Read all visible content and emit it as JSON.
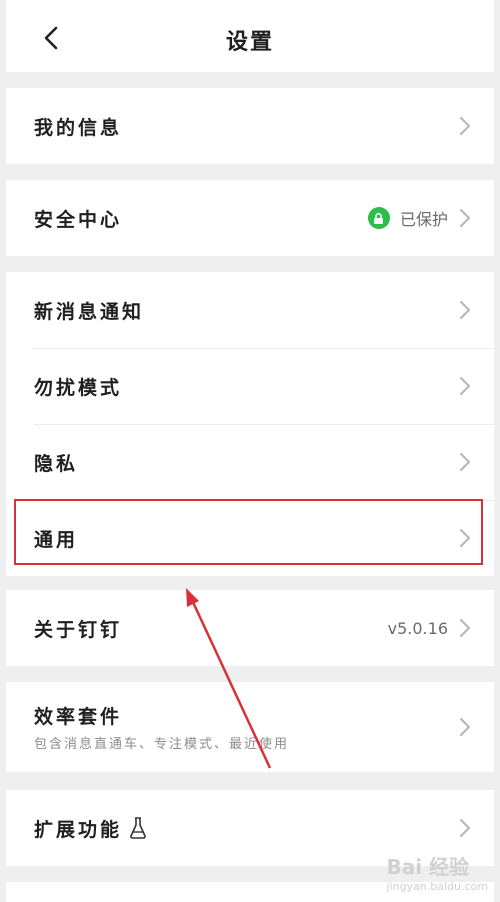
{
  "header": {
    "title": "设置",
    "back_icon": "chevron-left-icon"
  },
  "groups": {
    "my_info": {
      "label": "我的信息"
    },
    "security": {
      "label": "安全中心",
      "status": "已保护",
      "status_color": "#2bbe4b"
    },
    "notifications": {
      "items": [
        {
          "label": "新消息通知"
        },
        {
          "label": "勿扰模式"
        },
        {
          "label": "隐私"
        },
        {
          "label": "通用"
        }
      ]
    },
    "about": {
      "label": "关于钉钉",
      "version": "v5.0.16"
    },
    "efficiency": {
      "label": "效率套件",
      "subtitle": "包含消息直通车、专注模式、最近使用"
    },
    "extensions": {
      "label": "扩展功能",
      "icon": "flask-icon"
    }
  },
  "annotation": {
    "highlight_color": "#d9313a"
  },
  "watermark": {
    "text": "Bai 经验",
    "sub": "jingyan.baidu.com"
  }
}
